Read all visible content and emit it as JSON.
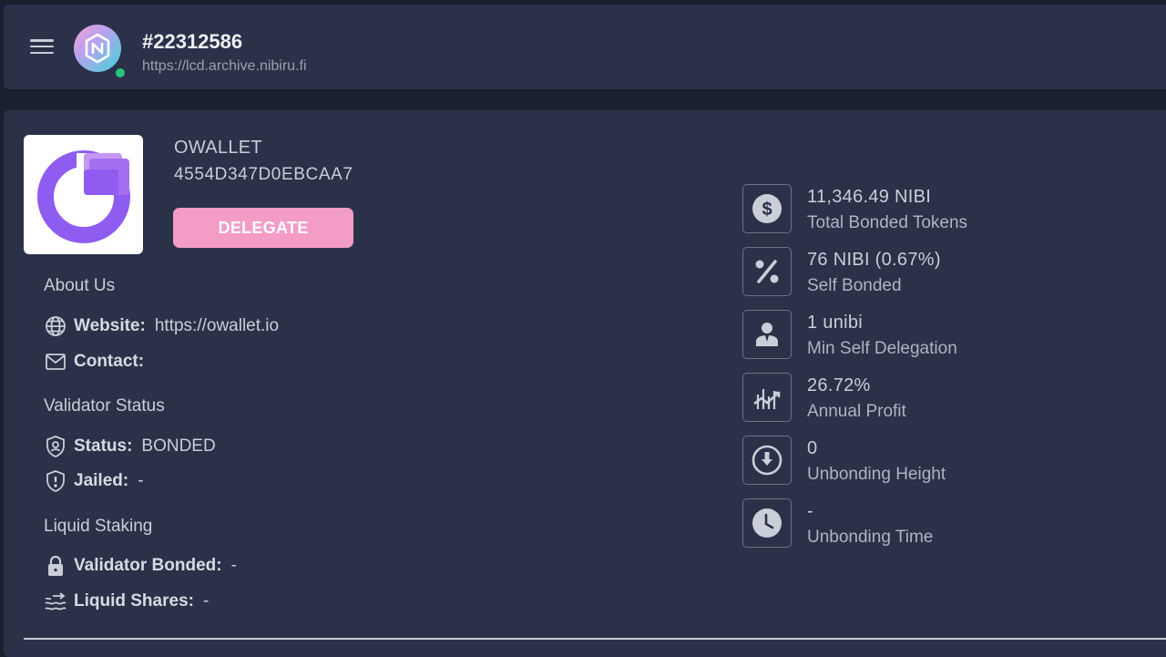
{
  "header": {
    "block_number": "#22312586",
    "endpoint_url": "https://lcd.archive.nibiru.fi",
    "status_color": "#27c47a"
  },
  "validator": {
    "name": "OWALLET",
    "identity": "4554D347D0EBCAA7",
    "delegate_label": "DELEGATE",
    "accent_color": "#f29cc6",
    "logo_color": "#8e5cf0"
  },
  "about": {
    "title": "About Us",
    "website_label": "Website:",
    "website_value": "https://owallet.io",
    "contact_label": "Contact:",
    "contact_value": ""
  },
  "status_section": {
    "title": "Validator Status",
    "status_label": "Status:",
    "status_value": "BONDED",
    "jailed_label": "Jailed:",
    "jailed_value": "-"
  },
  "liquid": {
    "title": "Liquid Staking",
    "bonded_label": "Validator Bonded:",
    "bonded_value": "-",
    "shares_label": "Liquid Shares:",
    "shares_value": "-"
  },
  "stats": [
    {
      "icon": "dollar-icon",
      "value": "11,346.49 NIBI",
      "label": "Total Bonded Tokens"
    },
    {
      "icon": "percent-icon",
      "value": "76 NIBI (0.67%)",
      "label": "Self Bonded"
    },
    {
      "icon": "person-icon",
      "value": "1 unibi",
      "label": "Min Self Delegation"
    },
    {
      "icon": "chart-growth-icon",
      "value": "26.72%",
      "label": "Annual Profit"
    },
    {
      "icon": "arrow-down-circle-icon",
      "value": "0",
      "label": "Unbonding Height"
    },
    {
      "icon": "clock-icon",
      "value": "-",
      "label": "Unbonding Time"
    }
  ]
}
